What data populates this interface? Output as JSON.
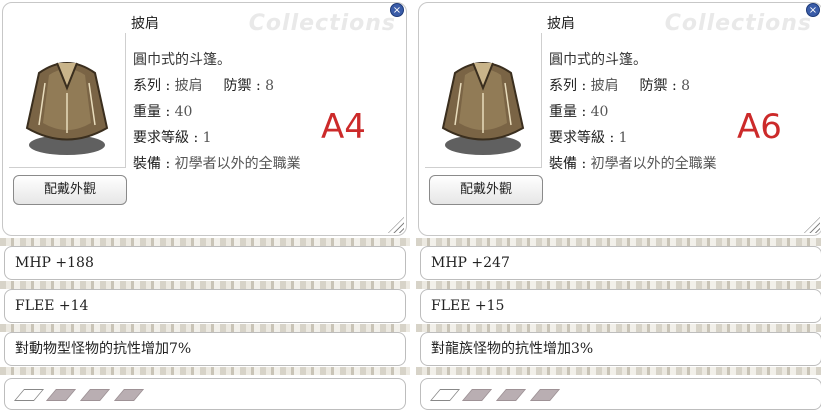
{
  "watermark": "Collections",
  "panels": [
    {
      "title": "披肩",
      "description": "圓巾式的斗篷。",
      "type_label": "系列 :",
      "type_value": "披肩",
      "defense_label": "防禦 :",
      "defense_value": "8",
      "weight_label": "重量 :",
      "weight_value": "40",
      "level_label": "要求等級 :",
      "level_value": "1",
      "equip_label": "裝備 :",
      "equip_value": "初學者以外的全職業",
      "grade": "A4",
      "view_button": "配戴外觀",
      "stats": [
        "MHP +188",
        "FLEE +14",
        "對動物型怪物的抗性增加7%"
      ],
      "slots": 4
    },
    {
      "title": "披肩",
      "description": "圓巾式的斗篷。",
      "type_label": "系列 :",
      "type_value": "披肩",
      "defense_label": "防禦 :",
      "defense_value": "8",
      "weight_label": "重量 :",
      "weight_value": "40",
      "level_label": "要求等級 :",
      "level_value": "1",
      "equip_label": "裝備 :",
      "equip_value": "初學者以外的全職業",
      "grade": "A6",
      "view_button": "配戴外觀",
      "stats": [
        "MHP +247",
        "FLEE +15",
        "對龍族怪物的抗性增加3%"
      ],
      "slots": 4
    }
  ],
  "colors": {
    "grade": "#cc2a2a",
    "close": "#3a5ca8"
  }
}
